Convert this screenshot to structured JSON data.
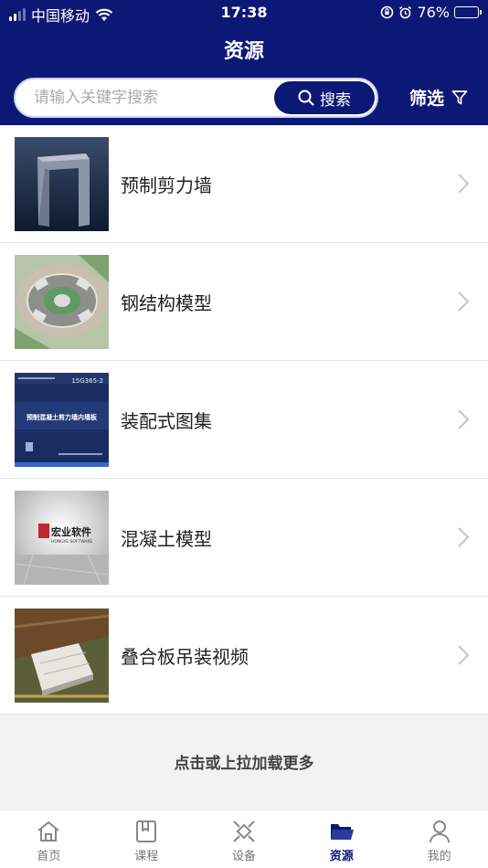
{
  "status_bar": {
    "carrier": "中国移动",
    "time": "17:38",
    "battery": "76%",
    "battery_level": 0.76
  },
  "header": {
    "title": "资源"
  },
  "search": {
    "placeholder": "请输入关键字搜索",
    "value": "",
    "button_label": "搜索"
  },
  "filter": {
    "label": "筛选"
  },
  "resources": [
    {
      "title": "预制剪力墙"
    },
    {
      "title": "钢结构模型"
    },
    {
      "title": "装配式图集"
    },
    {
      "title": "混凝土模型"
    },
    {
      "title": "叠合板吊装视频"
    }
  ],
  "thumb_text": {
    "atlas_code": "15G365-2",
    "atlas_title": "预制混凝土剪力墙内墙板",
    "logo_cn": "宏业软件",
    "logo_en": "HONGYE SOFTWARE"
  },
  "load_more": "点击或上拉加载更多",
  "tabs": [
    {
      "label": "首页",
      "icon": "home-icon",
      "active": false
    },
    {
      "label": "课程",
      "icon": "course-icon",
      "active": false
    },
    {
      "label": "设备",
      "icon": "device-icon",
      "active": false
    },
    {
      "label": "资源",
      "icon": "folder-icon",
      "active": true
    },
    {
      "label": "我的",
      "icon": "user-icon",
      "active": false
    }
  ],
  "colors": {
    "primary": "#0b1875",
    "background": "#f2f2f2"
  }
}
